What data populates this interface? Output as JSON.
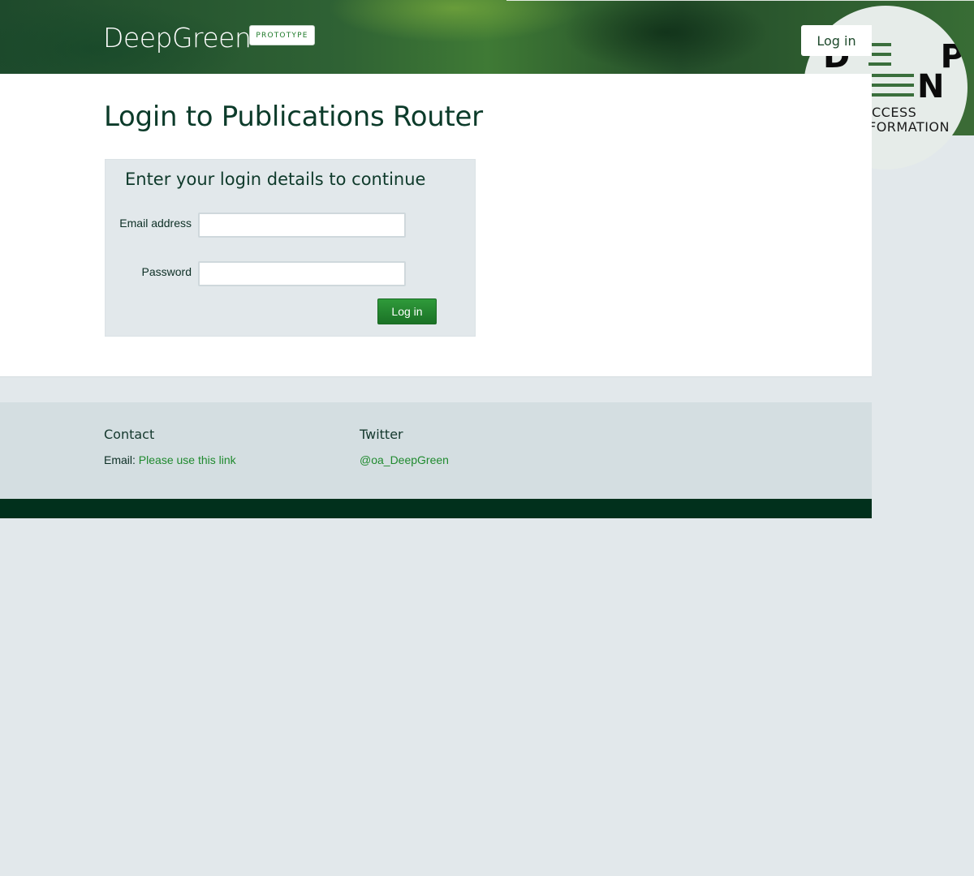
{
  "header": {
    "brand": "DeepGreen",
    "badge": "PROTOTYPE",
    "login_label": "Log in",
    "logo": {
      "line1": "D        P",
      "line2": "N",
      "sub1": "CCESS",
      "sub2": "FORMATION"
    }
  },
  "main": {
    "title": "Login to Publications Router",
    "panel": {
      "heading": "Enter your login details to continue",
      "email_label": "Email address",
      "email_value": "",
      "password_label": "Password",
      "password_value": "",
      "submit_label": "Log in"
    }
  },
  "footer": {
    "contact_heading": "Contact",
    "contact_prefix": "Email:",
    "contact_link": "Please use this link",
    "twitter_heading": "Twitter",
    "twitter_link": "@oa_DeepGreen"
  },
  "colors": {
    "accent": "#1f8a2e",
    "dark_green": "#01301c",
    "background": "#e2e8eb"
  }
}
